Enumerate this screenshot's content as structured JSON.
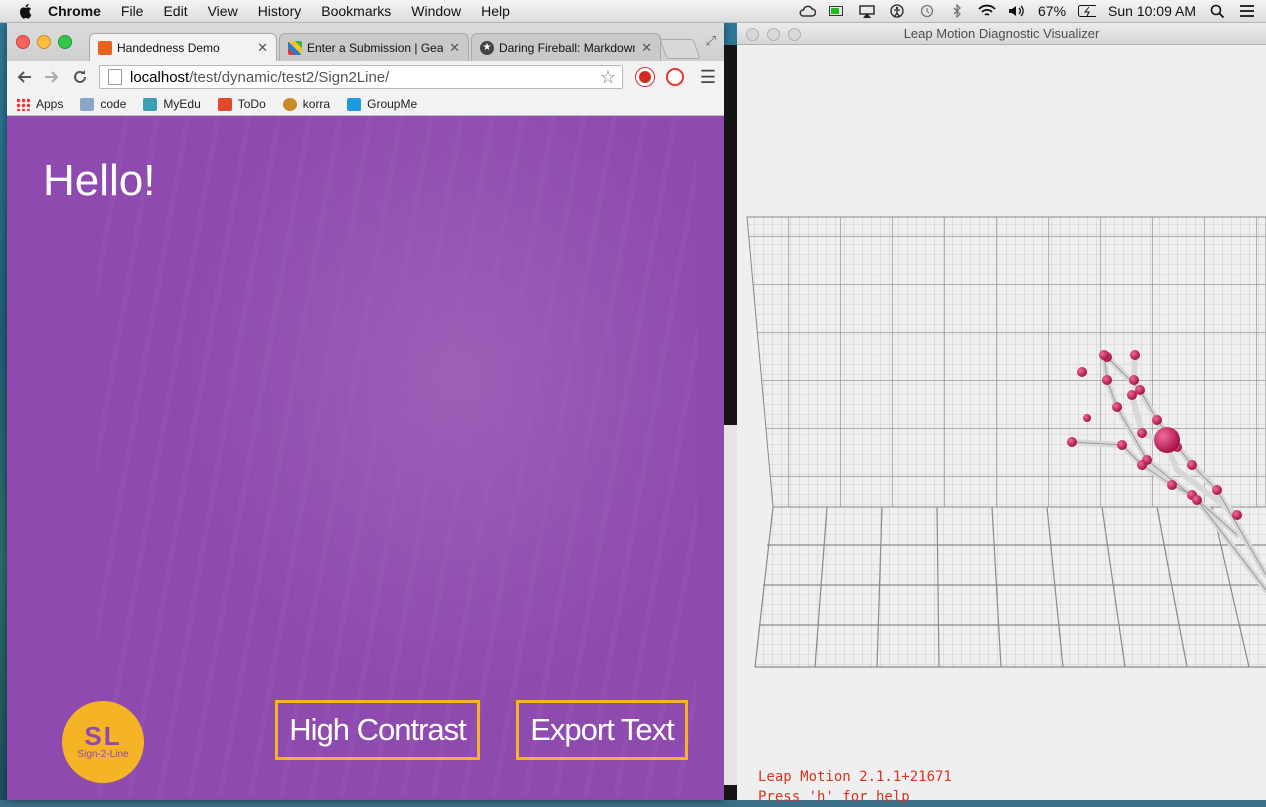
{
  "menubar": {
    "app": "Chrome",
    "items": [
      "File",
      "Edit",
      "View",
      "History",
      "Bookmarks",
      "Window",
      "Help"
    ],
    "battery": "67%",
    "clock": "Sun 10:09 AM"
  },
  "browser": {
    "tabs": [
      {
        "label": "Handedness Demo",
        "icon": "xampp-icon",
        "color": "#e8621c"
      },
      {
        "label": "Enter a Submission | Geau",
        "icon": "pinwheel-icon",
        "color": "#2a7bd8"
      },
      {
        "label": "Daring Fireball: Markdown",
        "icon": "star-icon",
        "color": "#444444"
      }
    ],
    "url_host": "localhost",
    "url_path": "/test/dynamic/test2/Sign2Line/",
    "bookmarks": [
      {
        "label": "Apps",
        "icon": "apps-grid-icon"
      },
      {
        "label": "code",
        "icon": "folder-icon"
      },
      {
        "label": "MyEdu",
        "icon": "graduation-cap-icon"
      },
      {
        "label": "ToDo",
        "icon": "todo-icon"
      },
      {
        "label": "korra",
        "icon": "korra-icon"
      },
      {
        "label": "GroupMe",
        "icon": "groupme-icon"
      }
    ]
  },
  "page": {
    "greeting": "Hello!",
    "logo_text": "SL",
    "logo_sub": "Sign-2-Line",
    "high_contrast_label": "High Contrast",
    "export_label": "Export Text",
    "colors": {
      "background": "#8e4aae",
      "accent": "#f4b425"
    }
  },
  "leap": {
    "title": "Leap Motion Diagnostic Visualizer",
    "version": "Leap Motion 2.1.1+21671",
    "help": "Press 'h' for help"
  }
}
